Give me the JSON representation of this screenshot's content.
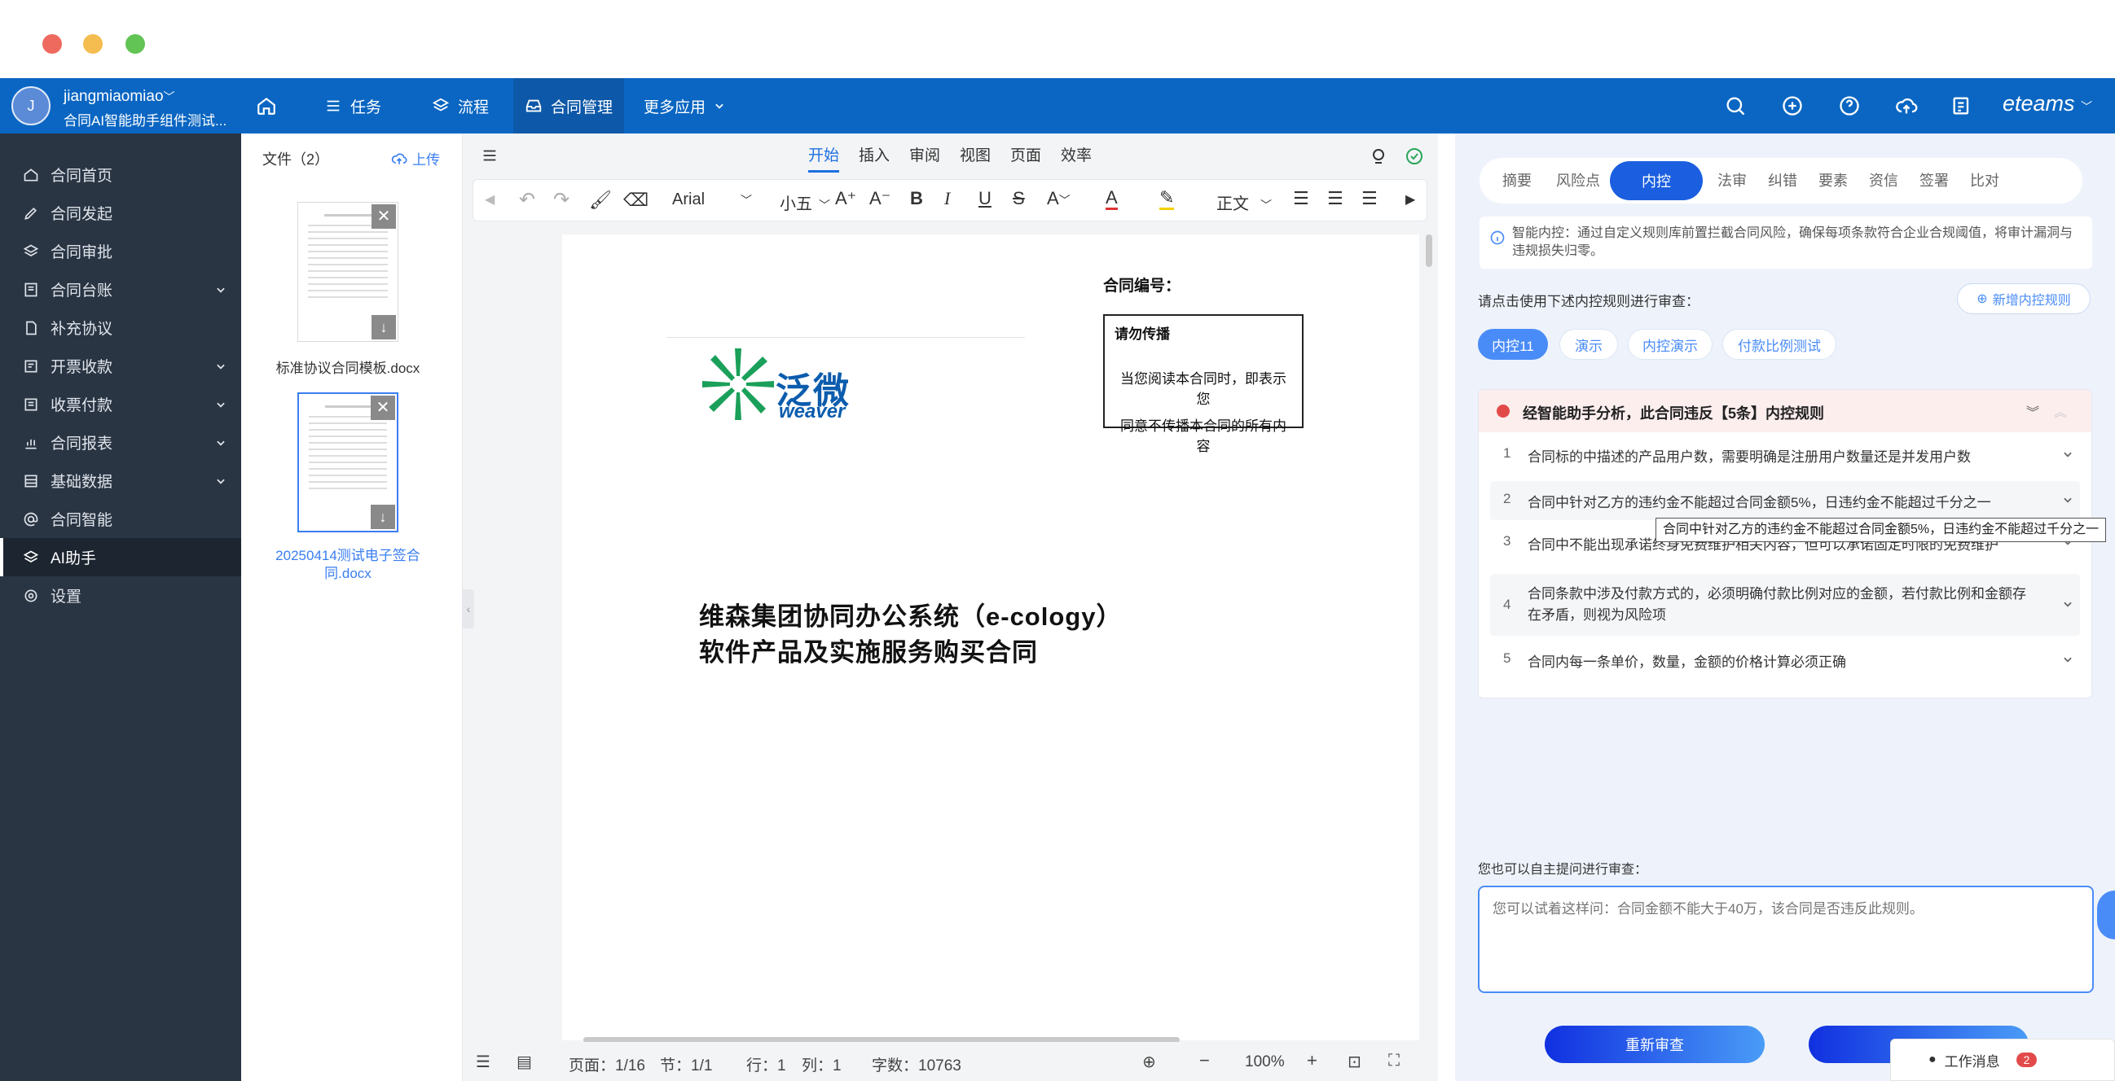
{
  "topnav": {
    "avatar_letter": "J",
    "user_name": "jiangmiaomiao",
    "user_sub": "合同AI智能助手组件测试...",
    "items": [
      {
        "label": "任务"
      },
      {
        "label": "流程"
      },
      {
        "label": "合同管理"
      },
      {
        "label": "更多应用"
      }
    ],
    "brand": "eteams"
  },
  "sidebar": {
    "items": [
      {
        "label": "合同首页",
        "icon": "home-icon"
      },
      {
        "label": "合同发起",
        "icon": "pen-icon"
      },
      {
        "label": "合同审批",
        "icon": "layers-icon"
      },
      {
        "label": "合同台账",
        "icon": "ledger-icon"
      },
      {
        "label": "补充协议",
        "icon": "doc-icon"
      },
      {
        "label": "开票收款",
        "icon": "invoice-icon"
      },
      {
        "label": "收票付款",
        "icon": "receipt-icon"
      },
      {
        "label": "合同报表",
        "icon": "chart-icon"
      },
      {
        "label": "基础数据",
        "icon": "table-icon"
      },
      {
        "label": "合同智能",
        "icon": "at-icon"
      },
      {
        "label": "AI助手",
        "icon": "layers-icon"
      },
      {
        "label": "设置",
        "icon": "gear-icon"
      }
    ]
  },
  "files": {
    "header": "文件（2）",
    "upload": "上传",
    "list": [
      {
        "name": "标准协议合同模板.docx"
      },
      {
        "name": "20250414测试电子签合同.docx"
      }
    ]
  },
  "doc": {
    "tabs": [
      "开始",
      "插入",
      "审阅",
      "视图",
      "页面",
      "效率"
    ],
    "font": "Arial",
    "size": "小五",
    "style": "正文",
    "contract_no_label": "合同编号：",
    "notice_title": "请勿传播",
    "notice_body_1": "当您阅读本合同时，即表示您",
    "notice_body_2": "同意不传播本合同的所有内容",
    "logo_cn": "泛微",
    "logo_en": "weaver",
    "title_1": "维森集团协同办公系统（e-cology）",
    "title_2": "软件产品及实施服务购买合同",
    "status": {
      "page": "页面：1/16",
      "section": "节：1/1",
      "row": "行：1",
      "col": "列：1",
      "words": "字数：10763",
      "zoom": "100%"
    }
  },
  "right": {
    "tabs": [
      "摘要",
      "风险点",
      "内控",
      "法审",
      "纠错",
      "要素",
      "资信",
      "签署",
      "比对"
    ],
    "info": "智能内控：通过自定义规则库前置拦截合同风险，确保每项条款符合企业合规阈值，将审计漏洞与违规损失归零。",
    "prompt": "请点击使用下述内控规则进行审查：",
    "add_rule": "新增内控规则",
    "chips": [
      "内控11",
      "演示",
      "内控演示",
      "付款比例测试"
    ],
    "result_title": "经智能助手分析，此合同违反【5条】内控规则",
    "rules": [
      {
        "n": "1",
        "text": "合同标的中描述的产品用户数，需要明确是注册用户数量还是并发用户数"
      },
      {
        "n": "2",
        "text": "合同中针对乙方的违约金不能超过合同金额5%，日违约金不能超过千分之一"
      },
      {
        "n": "3",
        "text": "合同中不能出现承诺终身免费维护相关内容，但可以承诺固定时限的免费维护"
      },
      {
        "n": "4",
        "text": "合同条款中涉及付款方式的，必须明确付款比例对应的金额，若付款比例和金额存在矛盾，则视为风险项"
      },
      {
        "n": "5",
        "text": "合同内每一条单价，数量，金额的价格计算必须正确"
      }
    ],
    "tooltip": "合同中针对乙方的违约金不能超过合同金额5%，日违约金不能超过千分之一",
    "self_ask": "您也可以自主提问进行审查：",
    "placeholder": "您可以试着这样问：合同金额不能大于40万，该合同是否违反此规则。",
    "recheck": "重新审查",
    "work_msg": "工作消息",
    "msg_count": "2"
  }
}
